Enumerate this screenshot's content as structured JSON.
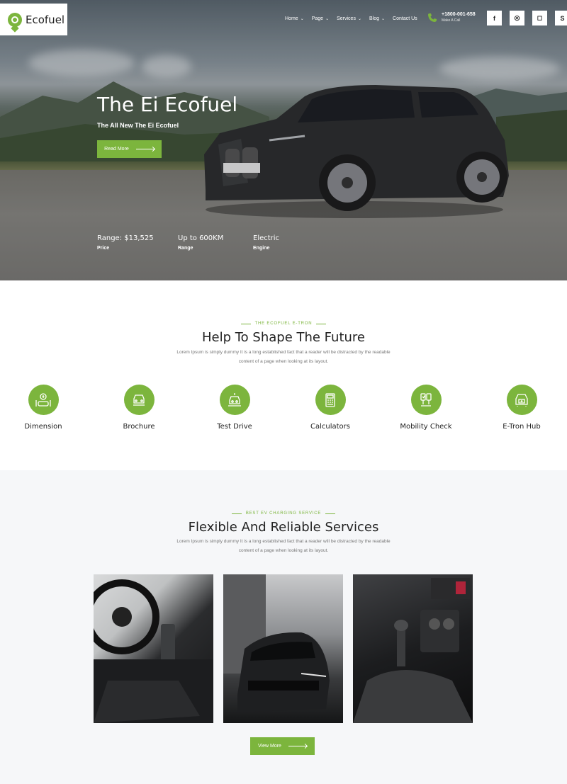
{
  "brand": {
    "name": "Ecofuel",
    "accent": "#7cb53d"
  },
  "nav": {
    "items": [
      {
        "label": "Home",
        "has_dropdown": true
      },
      {
        "label": "Page",
        "has_dropdown": true
      },
      {
        "label": "Services",
        "has_dropdown": true
      },
      {
        "label": "Blog",
        "has_dropdown": true
      },
      {
        "label": "Contact Us",
        "has_dropdown": false
      }
    ]
  },
  "contact": {
    "phone": "+1800-001-658",
    "caption": "Make A Call",
    "icon": "phone-icon"
  },
  "social": [
    {
      "name": "facebook-icon",
      "glyph": "f"
    },
    {
      "name": "github-icon",
      "glyph": "◎"
    },
    {
      "name": "instagram-icon",
      "glyph": "◻"
    },
    {
      "name": "skype-icon",
      "glyph": "S"
    }
  ],
  "hero": {
    "title": "The Ei Ecofuel",
    "subtitle": "The All New The Ei Ecofuel",
    "button_label": "Read More",
    "stats": [
      {
        "value": "Range: $13,525",
        "label": "Price"
      },
      {
        "value": "Up to 600KM",
        "label": "Range"
      },
      {
        "value": "Electric",
        "label": "Engine"
      }
    ]
  },
  "features_section": {
    "eyebrow": "THE ECOFUEL E-TRON",
    "title": "Help To Shape The Future",
    "description": "Lorem Ipsum is simply dummy It is a long established fact that a reader will be distracted by the readable content of a page when looking at its layout.",
    "items": [
      {
        "label": "Dimension",
        "icon": "dimension-icon"
      },
      {
        "label": "Brochure",
        "icon": "brochure-icon"
      },
      {
        "label": "Test Drive",
        "icon": "test-drive-icon"
      },
      {
        "label": "Calculators",
        "icon": "calculator-icon"
      },
      {
        "label": "Mobility Check",
        "icon": "mobility-check-icon"
      },
      {
        "label": "E-Tron Hub",
        "icon": "e-tron-hub-icon"
      }
    ]
  },
  "services_section": {
    "eyebrow": "BEST EV CHARGING SERVICE",
    "title": "Flexible And Reliable Services",
    "description": "Lorem Ipsum is simply dummy It is a long established fact that a reader will be distracted by the readable content of a page when looking at its layout.",
    "button_label": "View More"
  }
}
